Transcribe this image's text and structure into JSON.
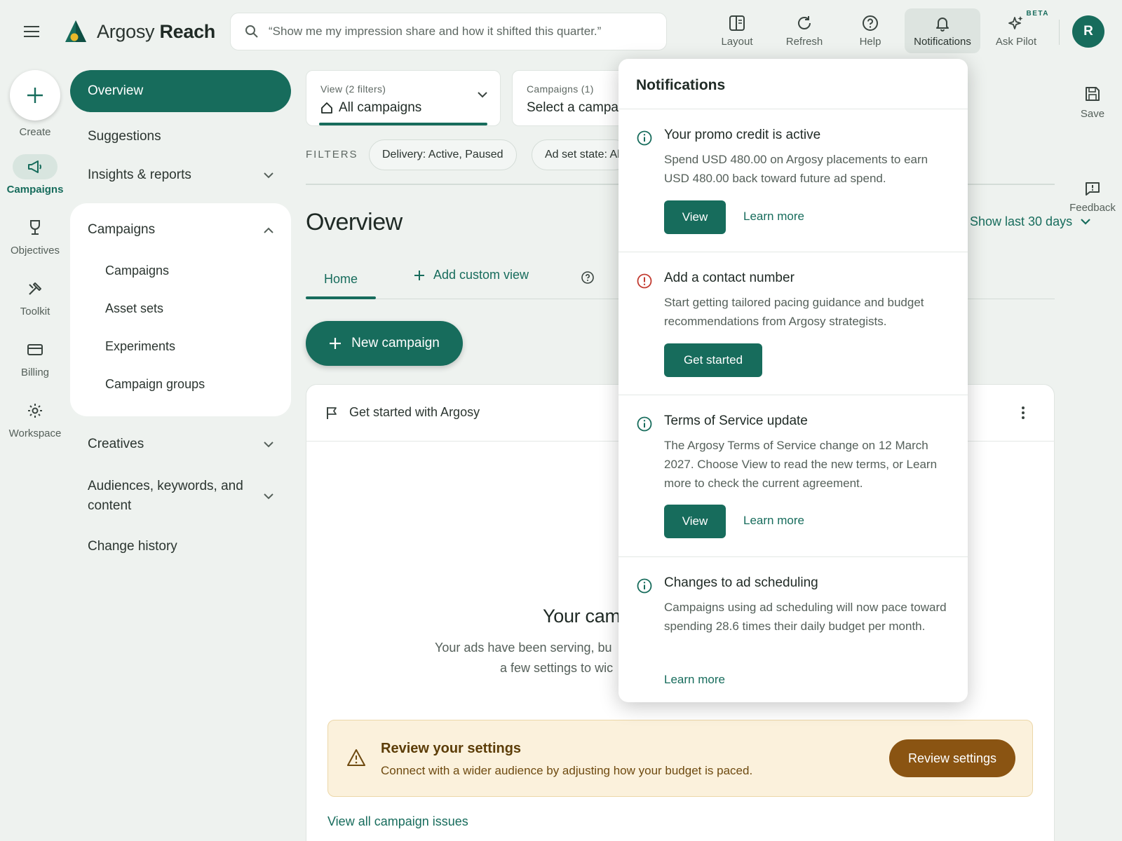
{
  "app": {
    "brand_prefix": "Argosy",
    "brand_suffix": "Reach",
    "search_placeholder": "“Show me my impression share and how it shifted this quarter.”",
    "avatar_initial": "R"
  },
  "top_actions": [
    {
      "label": "Layout",
      "icon": "layout-icon"
    },
    {
      "label": "Refresh",
      "icon": "refresh-icon"
    },
    {
      "label": "Help",
      "icon": "help-icon"
    },
    {
      "label": "Notifications",
      "icon": "bell-icon",
      "active": true
    },
    {
      "label": "Ask Pilot",
      "icon": "sparkle-icon",
      "badge": "BETA"
    }
  ],
  "rail": {
    "create": "Create",
    "items": [
      {
        "label": "Campaigns",
        "icon": "megaphone-icon",
        "active": true
      },
      {
        "label": "Objectives",
        "icon": "trophy-icon"
      },
      {
        "label": "Toolkit",
        "icon": "tools-icon"
      },
      {
        "label": "Billing",
        "icon": "credit-card-icon"
      },
      {
        "label": "Workspace",
        "icon": "gear-icon"
      }
    ]
  },
  "nav": {
    "overview": "Overview",
    "suggestions": "Suggestions",
    "insights": "Insights & reports",
    "campaigns_group": "Campaigns",
    "campaigns_sub": [
      "Campaigns",
      "Asset sets",
      "Experiments",
      "Campaign groups"
    ],
    "creatives": "Creatives",
    "audiences_line1": "Audiences, keywords, and",
    "audiences_line2": "content",
    "change_history": "Change history"
  },
  "main": {
    "view_label": "View (2 filters)",
    "view_value": "All campaigns",
    "campaigns_label": "Campaigns (1)",
    "campaigns_value": "Select a campaign",
    "filters_label": "FILTERS",
    "chips": [
      "Delivery: Active, Paused",
      "Ad set state: All"
    ],
    "title": "Overview",
    "date_range": "Show last 30 days",
    "tab_home": "Home",
    "tab_add": "Add custom view",
    "new_campaign": "New campaign",
    "panel_title": "Get started with Argosy",
    "empty_title": "Your cam",
    "empty_line1": "Your ads have been serving, bu",
    "empty_line2": "a few settings to wic",
    "warning": {
      "title": "Review your settings",
      "text": "Connect with a wider audience by adjusting how your budget is paced.",
      "button": "Review settings"
    },
    "view_all": "View all campaign issues"
  },
  "right_actions": {
    "save": "Save",
    "feedback": "Feedback"
  },
  "notifications": {
    "title": "Notifications",
    "items": [
      {
        "type": "info",
        "title": "Your promo credit is active",
        "body": "Spend USD 480.00 on Argosy placements to earn USD 480.00 back toward future ad spend.",
        "primary": "View",
        "secondary": "Learn more"
      },
      {
        "type": "alert",
        "title": "Add a contact number",
        "body": "Start getting tailored pacing guidance and budget recommendations from Argosy strategists.",
        "primary": "Get started"
      },
      {
        "type": "info",
        "title": "Terms of Service update",
        "body": "The Argosy Terms of Service change on 12 March 2027. Choose View to read the new terms, or Learn more to check the current agreement.",
        "primary": "View",
        "secondary": "Learn more"
      },
      {
        "type": "info",
        "title": "Changes to ad scheduling",
        "body": "Campaigns using ad scheduling will now pace toward spending 28.6 times their daily budget per month.",
        "secondary": "Learn more"
      }
    ]
  },
  "colors": {
    "accent": "#176c5c",
    "alert": "#c23b30",
    "warning_bg": "#fbf1dc",
    "warning_button": "#8a5412"
  }
}
